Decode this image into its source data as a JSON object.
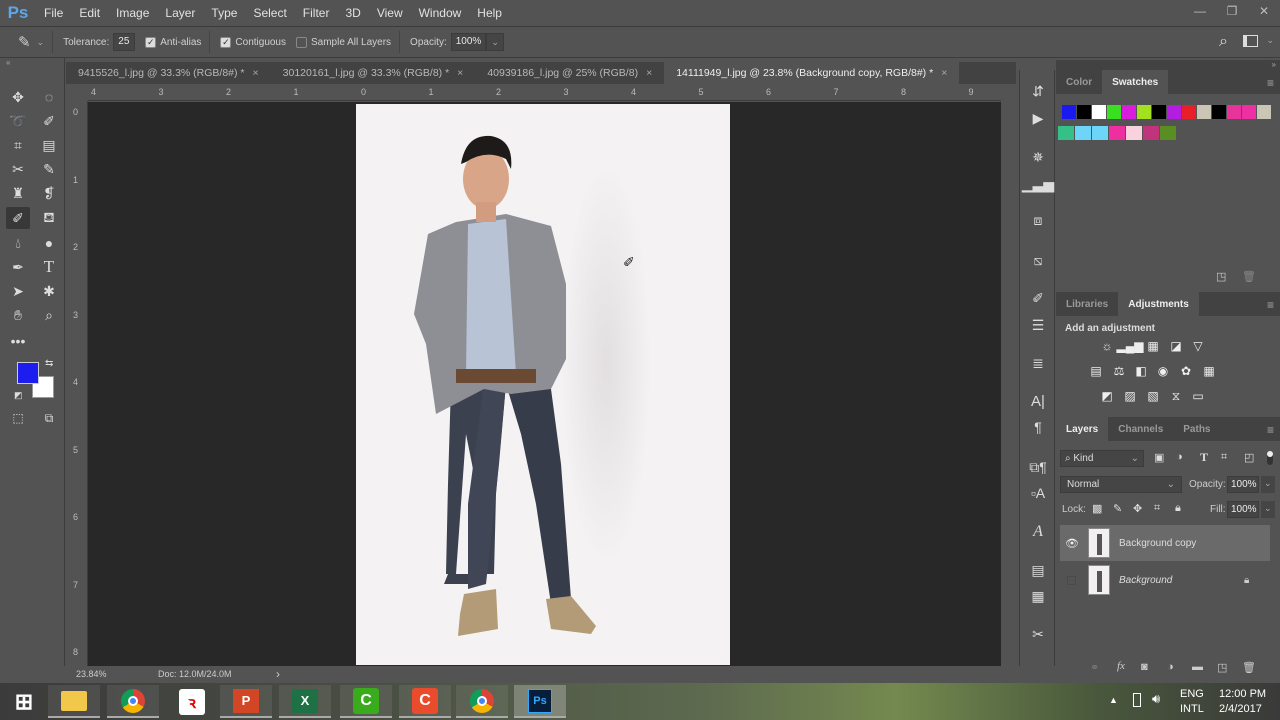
{
  "app": {
    "logo": "Ps"
  },
  "menu": [
    "File",
    "Edit",
    "Image",
    "Layer",
    "Type",
    "Select",
    "Filter",
    "3D",
    "View",
    "Window",
    "Help"
  ],
  "window_controls": {
    "minimize": "—",
    "restore": "❐",
    "close": "✕"
  },
  "options": {
    "tool_icon": "magic-eraser-icon",
    "tolerance_label": "Tolerance:",
    "tolerance_value": "25",
    "antialias_label": "Anti-alias",
    "antialias_checked": true,
    "contiguous_label": "Contiguous",
    "contiguous_checked": true,
    "sample_all_label": "Sample All Layers",
    "sample_all_checked": false,
    "opacity_label": "Opacity:",
    "opacity_value": "100%"
  },
  "tabs": [
    {
      "label": "9415526_l.jpg @ 33.3% (RGB/8#) *",
      "active": false
    },
    {
      "label": "30120161_l.jpg @ 33.3% (RGB/8) *",
      "active": false
    },
    {
      "label": "40939186_l.jpg @ 25% (RGB/8)",
      "active": false
    },
    {
      "label": "14111949_l.jpg @ 23.8% (Background copy, RGB/8#) *",
      "active": true
    }
  ],
  "tab_close": "×",
  "ruler_top": [
    "4",
    "3",
    "2",
    "1",
    "0",
    "1",
    "2",
    "3",
    "4",
    "5",
    "6",
    "7",
    "8",
    "9"
  ],
  "ruler_left": [
    "0",
    "1",
    "2",
    "3",
    "4",
    "5",
    "6",
    "7",
    "8"
  ],
  "status": {
    "zoom": "23.84%",
    "doc": "Doc: 12.0M/24.0M",
    "arrow": "›"
  },
  "colors": {
    "foreground": "#1d1df0",
    "background": "#ffffff"
  },
  "panels": {
    "color_tab": "Color",
    "swatches_tab": "Swatches",
    "swatches": [
      "#1a1af0",
      "#000000",
      "#ffffff",
      "#39e01f",
      "#d81ddc",
      "#a3e01e",
      "#000000",
      "#b21de0",
      "#e81e28",
      "#cac5b5",
      "#000000",
      "#e8349a",
      "#ee2fa3",
      "#cac5b5",
      "#35c08a",
      "#6dd6f8",
      "#6dd6f8",
      "#ed2f9f",
      "#f9d2de",
      "#c0347e",
      "#5a8d22"
    ],
    "libraries_tab": "Libraries",
    "adjustments_tab": "Adjustments",
    "add_adjustment": "Add an adjustment",
    "layers_tab": "Layers",
    "channels_tab": "Channels",
    "paths_tab": "Paths",
    "kind_label": "Kind",
    "blend_mode": "Normal",
    "opacity_label": "Opacity:",
    "opacity_value": "100%",
    "lock_label": "Lock:",
    "fill_label": "Fill:",
    "fill_value": "100%",
    "layers": [
      {
        "name": "Background copy",
        "visible": true,
        "selected": true,
        "locked": false
      },
      {
        "name": "Background",
        "visible": false,
        "selected": false,
        "locked": true
      }
    ]
  },
  "taskbar": {
    "apps": [
      "File Explorer",
      "Chrome",
      "Airtel",
      "PowerPoint",
      "Excel",
      "Camtasia Studio",
      "Camtasia Recorder",
      "Chrome",
      "Photoshop"
    ],
    "lang1": "ENG",
    "lang2": "INTL",
    "time": "12:00 PM",
    "date": "2/4/2017"
  }
}
